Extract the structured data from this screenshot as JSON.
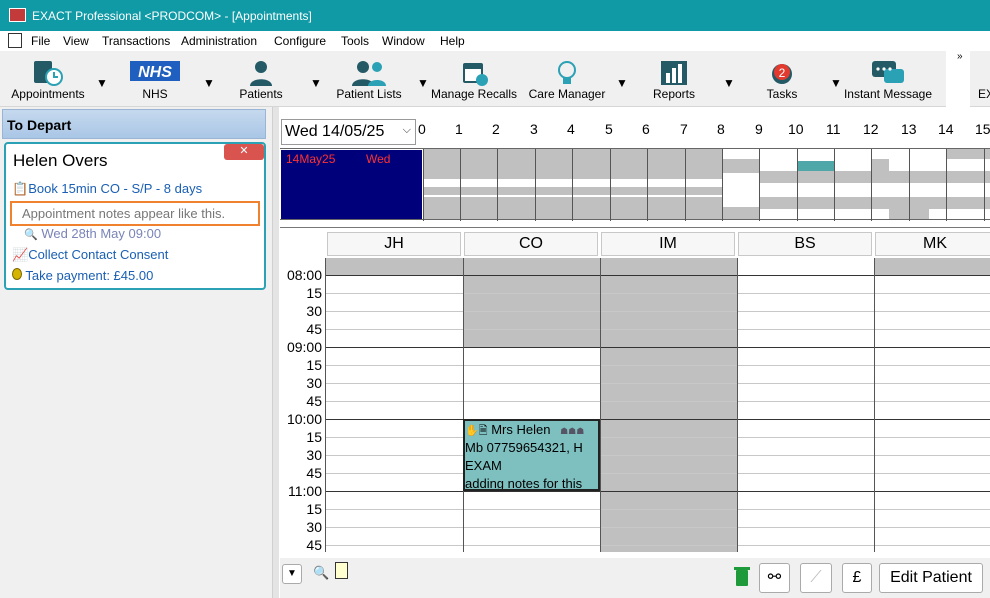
{
  "window": {
    "title": "EXACT Professional <PRODCOM> - [Appointments]"
  },
  "menu": [
    "File",
    "View",
    "Transactions",
    "Administration",
    "Configure",
    "Tools",
    "Window",
    "Help"
  ],
  "toolbar": {
    "items": [
      {
        "label": "Appointments",
        "icon": "appointments-icon"
      },
      {
        "label": "NHS",
        "icon": "nhs-logo-icon"
      },
      {
        "label": "Patients",
        "icon": "patient-icon"
      },
      {
        "label": "Patient Lists",
        "icon": "patient-lists-icon"
      },
      {
        "label": "Manage Recalls",
        "icon": "calendar-recall-icon"
      },
      {
        "label": "Care Manager",
        "icon": "lightbulb-icon"
      },
      {
        "label": "Reports",
        "icon": "reports-chart-icon"
      },
      {
        "label": "Tasks",
        "icon": "alarm-clock-icon",
        "badge": "2"
      },
      {
        "label": "Instant Message",
        "icon": "chat-bubbles-icon"
      },
      {
        "label": "EX",
        "icon": ""
      }
    ],
    "overflow": "»"
  },
  "left_panel": {
    "header": "To Depart",
    "patient_name": "Helen Overs",
    "close_glyph": "✕",
    "rows": {
      "book": "Book 15min CO - S/P - 8 days",
      "note": "Appointment notes appear like this.",
      "date": "Wed 28th May 09:00",
      "consent": "Collect Contact Consent",
      "payment": "Take payment: £45.00"
    }
  },
  "date_selector": {
    "value": "Wed 14/05/25"
  },
  "hour_ruler": [
    "0",
    "1",
    "2",
    "3",
    "4",
    "5",
    "6",
    "7",
    "8",
    "9",
    "10",
    "11",
    "12",
    "13",
    "14",
    "15"
  ],
  "overview": {
    "date_label": "14May25",
    "day_label": "Wed"
  },
  "columns": [
    "JH",
    "CO",
    "IM",
    "BS",
    "MK"
  ],
  "time_labels": [
    "08:00",
    "15",
    "30",
    "45",
    "09:00",
    "15",
    "30",
    "45",
    "10:00",
    "15",
    "30",
    "45",
    "11:00",
    "15",
    "30",
    "45"
  ],
  "appointment": {
    "lines": [
      "Mrs Helen",
      "Mb 07759654321, H",
      "EXAM",
      "adding notes for this"
    ],
    "color": "#7ebfbf"
  },
  "bottom": {
    "edit_patient": "Edit Patient",
    "pound": "£"
  },
  "colors": {
    "titlebar": "#0f9aa6",
    "overview_selected": "#00007b",
    "note_border": "#f0812e"
  }
}
